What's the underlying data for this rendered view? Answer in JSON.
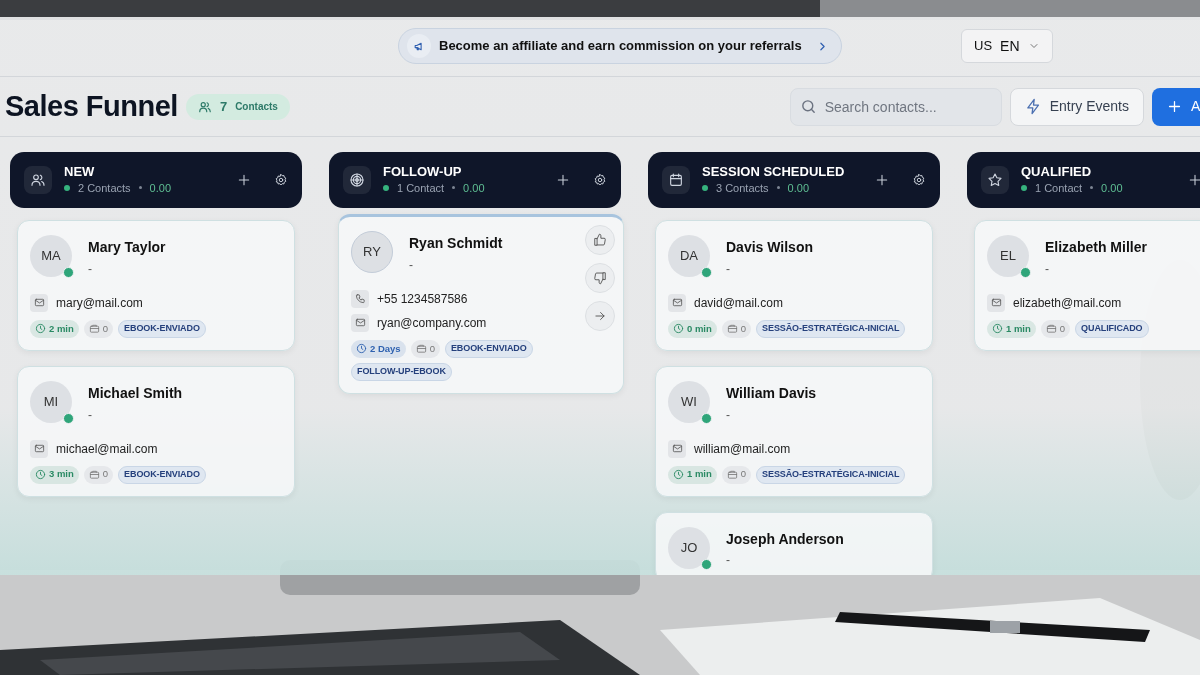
{
  "banner": {
    "text": "Become an affiliate and earn commission on your referrals"
  },
  "language": {
    "region": "US",
    "code": "EN"
  },
  "title": "Sales Funnel",
  "contacts_badge": {
    "count": "7",
    "label": "Contacts"
  },
  "search": {
    "placeholder": "Search contacts..."
  },
  "buttons": [
    {
      "label": "Entry Events",
      "kind": "outline"
    },
    {
      "label": "A",
      "kind": "primary"
    }
  ],
  "columns": [
    {
      "title": "NEW",
      "count": "2 Contacts",
      "amount": "0.00",
      "settings": true,
      "cards": [
        {
          "initials": "MA",
          "name": "Mary Taylor",
          "subtitle": "-",
          "online": true,
          "email": "mary@mail.com",
          "time": "2 min",
          "color": "#2a8a64",
          "tasks": "0",
          "tags": [
            "EBOOK-ENVIADO"
          ]
        },
        {
          "initials": "MI",
          "name": "Michael Smith",
          "subtitle": "-",
          "online": true,
          "email": "michael@mail.com",
          "time": "3 min",
          "color": "#2a8a64",
          "tasks": "0",
          "tags": [
            "EBOOK-ENVIADO"
          ]
        }
      ]
    },
    {
      "title": "FOLLOW-UP",
      "count": "1 Contact",
      "amount": "0.00",
      "settings": true,
      "cards": [
        {
          "initials": "RY",
          "name": "Ryan Schmidt",
          "subtitle": "-",
          "online": false,
          "phone": "+55 1234587586",
          "email": "ryan@company.com",
          "time": "2 Days",
          "color": "#2f62b0",
          "tasks": "0",
          "tags": [
            "EBOOK-ENVIADO",
            "FOLLOW-UP-EBOOK"
          ],
          "actions": [
            {
              "kind": "like"
            },
            {
              "kind": "dislike"
            },
            {
              "kind": "move"
            }
          ]
        }
      ]
    },
    {
      "title": "SESSION SCHEDULED",
      "count": "3 Contacts",
      "amount": "0.00",
      "settings": true,
      "cards": [
        {
          "initials": "DA",
          "name": "Davis Wilson",
          "subtitle": "-",
          "online": true,
          "email": "david@mail.com",
          "time": "0 min",
          "color": "#2a8a64",
          "tasks": "0",
          "tags": [
            "SESSÃO-ESTRATÉGICA-INICIAL"
          ]
        },
        {
          "initials": "WI",
          "name": "William Davis",
          "subtitle": "-",
          "online": true,
          "email": "william@mail.com",
          "time": "1 min",
          "color": "#2a8a64",
          "tasks": "0",
          "tags": [
            "SESSÃO-ESTRATÉGICA-INICIAL"
          ]
        },
        {
          "initials": "JO",
          "name": "Joseph Anderson",
          "subtitle": "-",
          "online": true
        }
      ]
    },
    {
      "title": "QUALIFIED",
      "count": "1 Contact",
      "amount": "0.00",
      "settings": false,
      "cards": [
        {
          "initials": "EL",
          "name": "Elizabeth Miller",
          "subtitle": "-",
          "online": true,
          "email": "elizabeth@mail.com",
          "time": "1 min",
          "color": "#2a8a64",
          "tasks": "0",
          "tags": [
            "QUALIFICADO"
          ]
        }
      ]
    }
  ]
}
